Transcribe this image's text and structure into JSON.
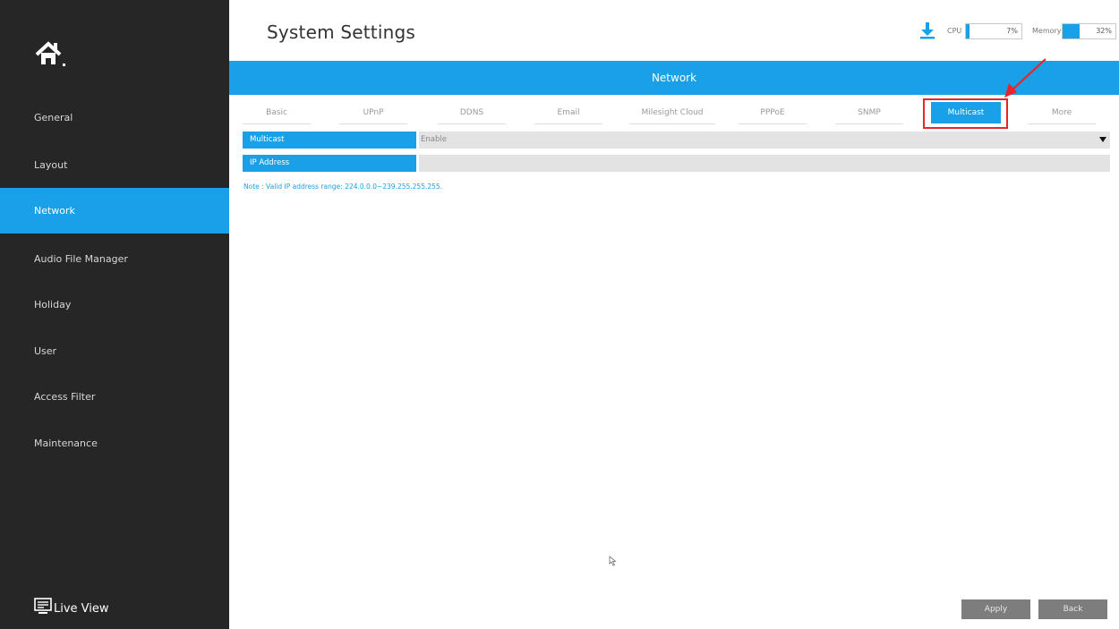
{
  "header": {
    "title": "System Settings"
  },
  "stats": {
    "cpu_label": "CPU",
    "cpu_value": "7%",
    "cpu_fraction": 0.07,
    "memory_label": "Memory",
    "memory_value": "32%",
    "memory_fraction": 0.32
  },
  "sidebar": {
    "items": [
      {
        "label": "General"
      },
      {
        "label": "Layout"
      },
      {
        "label": "Network"
      },
      {
        "label": "Audio File Manager"
      },
      {
        "label": "Holiday"
      },
      {
        "label": "User"
      },
      {
        "label": "Access Filter"
      },
      {
        "label": "Maintenance"
      }
    ],
    "active": "Network",
    "live_view": "Live View"
  },
  "section_title": "Network",
  "tabs": [
    {
      "label": "Basic"
    },
    {
      "label": "UPnP"
    },
    {
      "label": "DDNS"
    },
    {
      "label": "Email"
    },
    {
      "label": "Milesight Cloud"
    },
    {
      "label": "PPPoE"
    },
    {
      "label": "SNMP"
    },
    {
      "label": "Multicast"
    },
    {
      "label": "More"
    }
  ],
  "active_tab": "Multicast",
  "form": {
    "multicast_label": "Multicast",
    "multicast_value": "Enable",
    "ip_label": "IP Address",
    "ip_value": "",
    "note": "Note : Valid IP address range: 224.0.0.0~239.255.255.255."
  },
  "buttons": {
    "apply": "Apply",
    "back": "Back"
  },
  "colors": {
    "accent": "#1aa0e6",
    "sidebar": "#262626",
    "highlight": "#e8252a"
  }
}
